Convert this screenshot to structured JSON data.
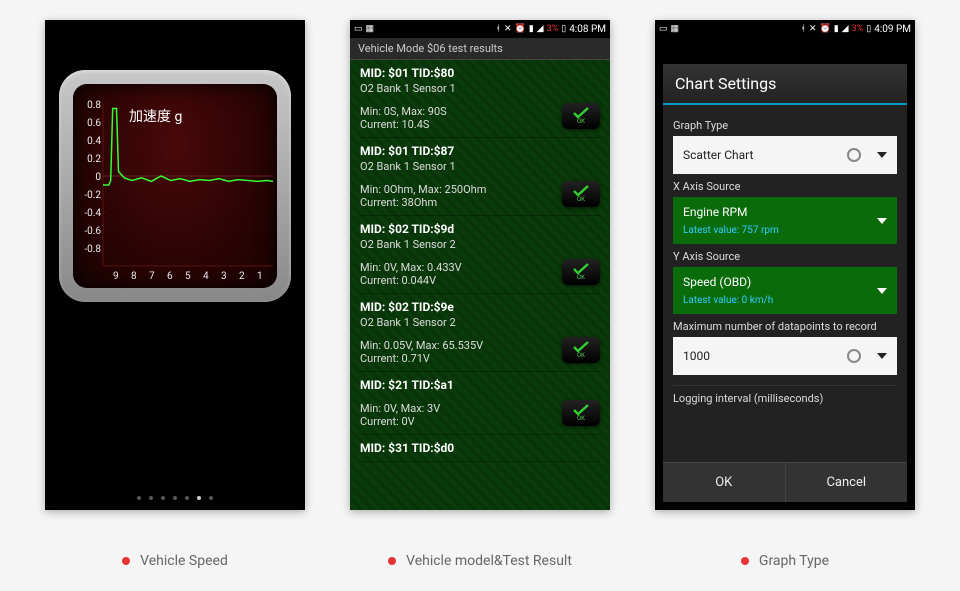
{
  "captions": [
    "Vehicle Speed",
    "Vehicle model&Test Result",
    "Graph Type"
  ],
  "status": {
    "battery_pct": "3%",
    "time2": "4:08 PM",
    "time3": "4:09 PM"
  },
  "panel1": {
    "title": "加速度 g",
    "y_ticks": [
      "0.8",
      "0.6",
      "0.4",
      "0.2",
      "0",
      "-0.2",
      "-0.4",
      "-0.6",
      "-0.8"
    ],
    "x_ticks": [
      "9",
      "8",
      "7",
      "6",
      "5",
      "4",
      "3",
      "2",
      "1"
    ],
    "page_dots": 7,
    "active_dot": 5
  },
  "panel2": {
    "header": "Vehicle Mode $06 test results",
    "items": [
      {
        "mid": "MID: $01 TID:$80",
        "sensor": "O2 Bank 1 Sensor 1",
        "min": "Min: 0S, Max: 90S",
        "cur": "Current: 10.4S"
      },
      {
        "mid": "MID: $01 TID:$87",
        "sensor": "O2 Bank 1 Sensor 1",
        "min": "Min: 0Ohm, Max: 250Ohm",
        "cur": "Current: 38Ohm"
      },
      {
        "mid": "MID: $02 TID:$9d",
        "sensor": "O2 Bank 1 Sensor 2",
        "min": "Min: 0V, Max: 0.433V",
        "cur": "Current: 0.044V"
      },
      {
        "mid": "MID: $02 TID:$9e",
        "sensor": "O2 Bank 1 Sensor 2",
        "min": "Min: 0.05V, Max: 65.535V",
        "cur": "Current: 0.71V"
      },
      {
        "mid": "MID: $21 TID:$a1",
        "sensor": "",
        "min": "Min: 0V, Max: 3V",
        "cur": "Current: 0V"
      },
      {
        "mid": "MID: $31 TID:$d0",
        "sensor": "",
        "min": "",
        "cur": ""
      }
    ],
    "ok": "OK"
  },
  "panel3": {
    "title": "Chart Settings",
    "graph_type_label": "Graph Type",
    "graph_type_value": "Scatter Chart",
    "x_label": "X Axis Source",
    "x_value": "Engine RPM",
    "x_latest": "Latest value: 757 rpm",
    "y_label": "Y Axis Source",
    "y_value": "Speed (OBD)",
    "y_latest": "Latest value: 0 km/h",
    "max_label": "Maximum number of datapoints to record",
    "max_value": "1000",
    "interval_label": "Logging interval (milliseconds)",
    "ok": "OK",
    "cancel": "Cancel"
  },
  "chart_data": {
    "type": "line",
    "title": "加速度 g",
    "xlabel": "",
    "ylabel": "",
    "ylim": [
      -0.9,
      0.9
    ],
    "x": [
      9.5,
      9.3,
      9.2,
      9.1,
      9.0,
      8.9,
      8.85,
      8.8,
      8.7,
      8.4,
      8.0,
      7.5,
      7.0,
      6.5,
      6.0,
      5.5,
      5.0,
      4.5,
      4.0,
      3.5,
      3.0,
      2.5,
      2.0,
      1.5,
      1.0,
      0.7
    ],
    "values": [
      0.0,
      0.0,
      0.0,
      0.05,
      0.85,
      0.85,
      0.85,
      0.85,
      0.15,
      0.08,
      0.05,
      0.08,
      0.04,
      0.1,
      0.05,
      0.07,
      0.04,
      0.06,
      0.05,
      0.07,
      0.04,
      0.06,
      0.05,
      0.04,
      0.05,
      0.04
    ]
  }
}
